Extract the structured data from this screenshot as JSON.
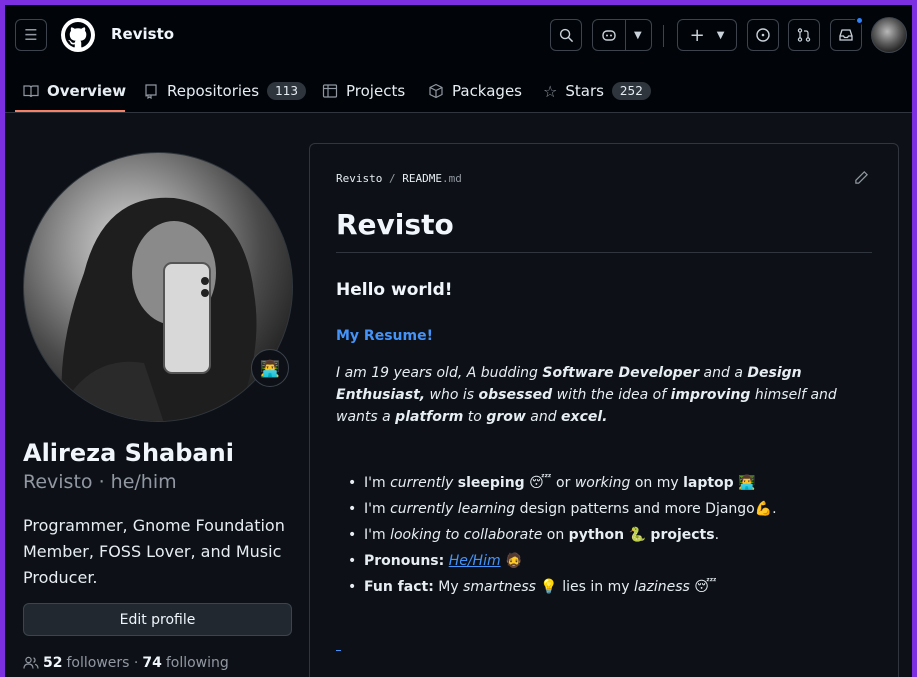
{
  "header": {
    "username": "Revisto",
    "tabs": [
      {
        "label": "Overview"
      },
      {
        "label": "Repositories",
        "count": "113"
      },
      {
        "label": "Projects"
      },
      {
        "label": "Packages"
      },
      {
        "label": "Stars",
        "count": "252"
      }
    ]
  },
  "profile": {
    "fullname": "Alireza Shabani",
    "login_line": "Revisto · he/him",
    "bio": "Programmer, Gnome Foundation Member, FOSS Lover, and Music Producer.",
    "edit_label": "Edit profile",
    "followers_count": "52",
    "followers_label": "followers ·",
    "following_count": "74",
    "following_label": "following",
    "status_emoji": "👨‍💻"
  },
  "readme": {
    "path_user": "Revisto",
    "path_sep": "/",
    "path_file": "README",
    "path_ext": ".md",
    "title": "Revisto",
    "hello": "Hello world!",
    "resume_link": "My Resume!",
    "intro": {
      "p1": "I am 19 years old, A budding ",
      "b1": "Software Developer",
      "p2": " and a ",
      "b2": "Design Enthusiast,",
      "p3": "  who is ",
      "b3": "obsessed",
      "p4": " with the idea of ",
      "b4": "improving",
      "p5": " himself and wants a ",
      "b5": "platform",
      "p6": " to ",
      "b6": "grow",
      "p7": " and ",
      "b7": "excel."
    },
    "bullets": {
      "b1": {
        "t1": "I'm ",
        "i1": "currently",
        "t2": " ",
        "s1": "sleeping",
        "e1": " 😴",
        "t3": " or ",
        "i2": "working",
        "t4": " on my ",
        "s2": "laptop",
        "e2": " 👨‍💻"
      },
      "b2": {
        "t1": "I'm ",
        "i1": "currently learning",
        "t2": " design patterns and more Django",
        "e1": "💪",
        "t3": "."
      },
      "b3": {
        "t1": "I'm ",
        "i1": "looking to collaborate",
        "t2": " on ",
        "s1": "python",
        "e1": " 🐍 ",
        "s2": "projects",
        "t3": "."
      },
      "b4": {
        "s1": "Pronouns:",
        "l1": "He/Him",
        "e1": " 🧔"
      },
      "b5": {
        "s1": "Fun fact:",
        "t1": " My ",
        "i1": "smartness",
        "e1": " 💡",
        "t2": " lies in my ",
        "i2": "laziness",
        "e2": " 😴"
      }
    }
  }
}
